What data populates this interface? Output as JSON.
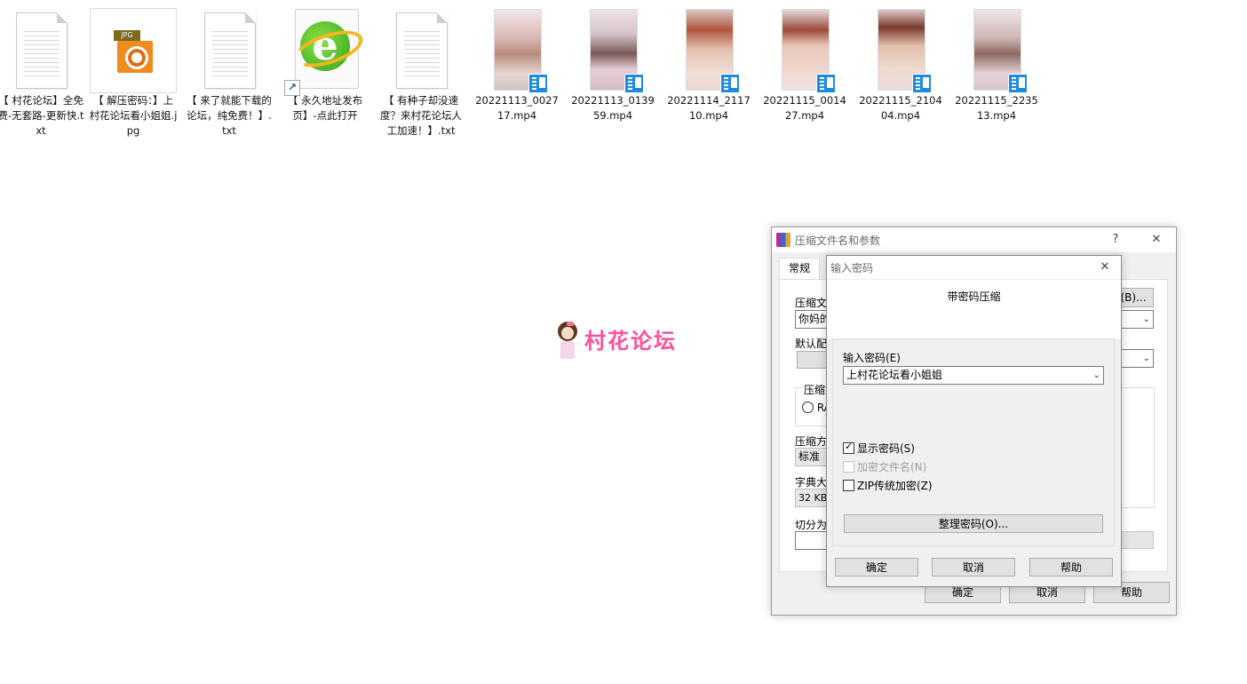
{
  "desktop": {
    "files": [
      {
        "label": "【 村花论坛】全免费-无套路-更新快.txt",
        "kind": "txt"
      },
      {
        "label": "【 解压密码：】上村花论坛看小姐姐.jpg",
        "kind": "jpg"
      },
      {
        "label": "【 来了就能下载的论坛，纯免费！】.txt",
        "kind": "txt"
      },
      {
        "label": "【 永久地址发布页】-点此打开",
        "kind": "url"
      },
      {
        "label": "【 有种子却没速度？来村花论坛人工加速！】.txt",
        "kind": "txt"
      },
      {
        "label": "20221113_002717.mp4",
        "kind": "mp4"
      },
      {
        "label": "20221113_013959.mp4",
        "kind": "mp4"
      },
      {
        "label": "20221114_211710.mp4",
        "kind": "mp4"
      },
      {
        "label": "20221115_001427.mp4",
        "kind": "mp4"
      },
      {
        "label": "20221115_210404.mp4",
        "kind": "mp4"
      },
      {
        "label": "20221115_223513.mp4",
        "kind": "mp4"
      }
    ],
    "jpg_tag": "JPG",
    "ie_letter": "e",
    "shortcut_glyph": "↗"
  },
  "watermark": {
    "text": "村花论坛"
  },
  "archive_dialog": {
    "title": "压缩文件名和参数",
    "help_glyph": "?",
    "close_glyph": "✕",
    "tab_general": "常规",
    "archive_name_label": "压缩文",
    "archive_name_value": "你妈的",
    "browse_button": "(B)...",
    "profile_label": "默认配",
    "format_group_label": "压缩文",
    "format_rar": "RA",
    "method_label": "压缩方",
    "method_value": "标准",
    "dict_label": "字典大",
    "dict_value": "32 KB",
    "split_label": "切分为",
    "ok": "确定",
    "cancel": "取消",
    "help": "帮助"
  },
  "password_dialog": {
    "title": "输入密码",
    "close_glyph": "✕",
    "heading": "带密码压缩",
    "enter_label": "输入密码(E)",
    "password_value": "上村花论坛看小姐姐",
    "show_password": {
      "label": "显示密码(S)",
      "checked": true
    },
    "encrypt_names": {
      "label": "加密文件名(N)",
      "checked": false,
      "disabled": true
    },
    "zip_legacy": {
      "label": "ZIP传统加密(Z)",
      "checked": false
    },
    "organize_button": "整理密码(O)...",
    "ok": "确定",
    "cancel": "取消",
    "help": "帮助"
  }
}
